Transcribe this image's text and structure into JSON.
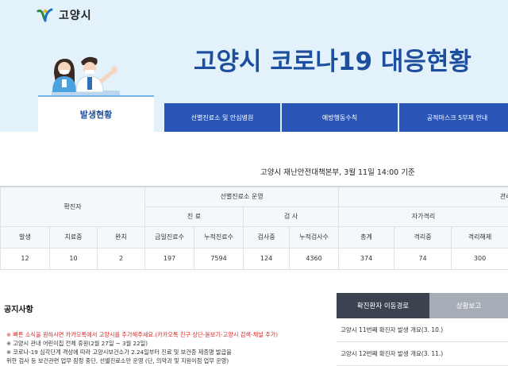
{
  "header": {
    "logo_text": "고양시",
    "title": "고양시 코로나19 대응현황"
  },
  "tabs": [
    {
      "label": "발생현황",
      "active": true
    },
    {
      "label": "선별진료소 및 안심병원",
      "active": false
    },
    {
      "label": "예방행동수칙",
      "active": false
    },
    {
      "label": "공적마스크 5부제 안내",
      "active": false
    }
  ],
  "date_line": "고양시 재난안전대책본부, 3월 11일 14:00 기준",
  "stats_table": {
    "group_confirmed": "확진자",
    "group_screening": "선별진료소 운영",
    "group_management": "관리대",
    "sub_treatment": "진 료",
    "sub_test": "검 사",
    "sub_isolation": "자가격리",
    "columns": [
      "발생",
      "치료중",
      "완치",
      "금일진료수",
      "누적진료수",
      "검사중",
      "누적검사수",
      "총계",
      "격리중",
      "격리해제"
    ],
    "values": [
      "12",
      "10",
      "2",
      "197",
      "7594",
      "124",
      "4360",
      "374",
      "74",
      "300"
    ]
  },
  "notice": {
    "title": "공지사항",
    "highlight": "※ 빠른 소식을 원하시면 카카오톡에서 고양시를 추가해주세요.(카카오톡 친구 상단-돋보기-고양시 검색-채널 추가)",
    "lines": [
      "※ 고양시 관내 어린이집 전체 휴원(2월 27일 ~ 3월 22일)",
      "※ 코로나-19 심각단계 격상에 따라 고양시보건소가 2.24일부터 진료 및 보건증 제증명 발급을",
      "위한 검사 등 보건관련 업무 잠정 중단, 선별진료소만 운영 (단, 의약과 및 지원이점 업무 운영)"
    ]
  },
  "side": {
    "tab_active": "확진환자 이동경로",
    "tab_inactive": "상황보고",
    "items": [
      "고양시 11번째 확진자 발생 개요(3. 10.)",
      "고양시 12번째 확진자 발생 개요(3. 11.)"
    ]
  },
  "colors": {
    "hero_bg": "#e3f1fb",
    "title": "#1d4f9e",
    "tab_bg": "#2a56b8",
    "notice_red": "#d62a2a",
    "side_tab_dark": "#3c4350",
    "side_tab_light": "#a6adb7"
  }
}
